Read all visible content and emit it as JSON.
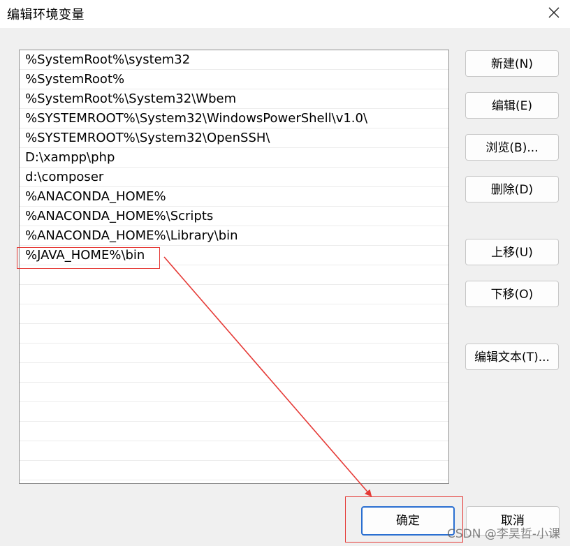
{
  "window": {
    "title": "编辑环境变量",
    "close_icon": "close-icon"
  },
  "paths": [
    "%SystemRoot%\\system32",
    "%SystemRoot%",
    "%SystemRoot%\\System32\\Wbem",
    "%SYSTEMROOT%\\System32\\WindowsPowerShell\\v1.0\\",
    "%SYSTEMROOT%\\System32\\OpenSSH\\",
    "D:\\xampp\\php",
    "d:\\composer",
    "%ANACONDA_HOME%",
    "%ANACONDA_HOME%\\Scripts",
    "%ANACONDA_HOME%\\Library\\bin",
    "%JAVA_HOME%\\bin"
  ],
  "buttons": {
    "new": "新建(N)",
    "edit": "编辑(E)",
    "browse": "浏览(B)...",
    "delete": "删除(D)",
    "move_up": "上移(U)",
    "move_down": "下移(O)",
    "edit_text": "编辑文本(T)...",
    "ok": "确定",
    "cancel": "取消"
  },
  "annotation": {
    "color": "#e53935"
  },
  "watermark": "CSDN @李昊哲-小课"
}
